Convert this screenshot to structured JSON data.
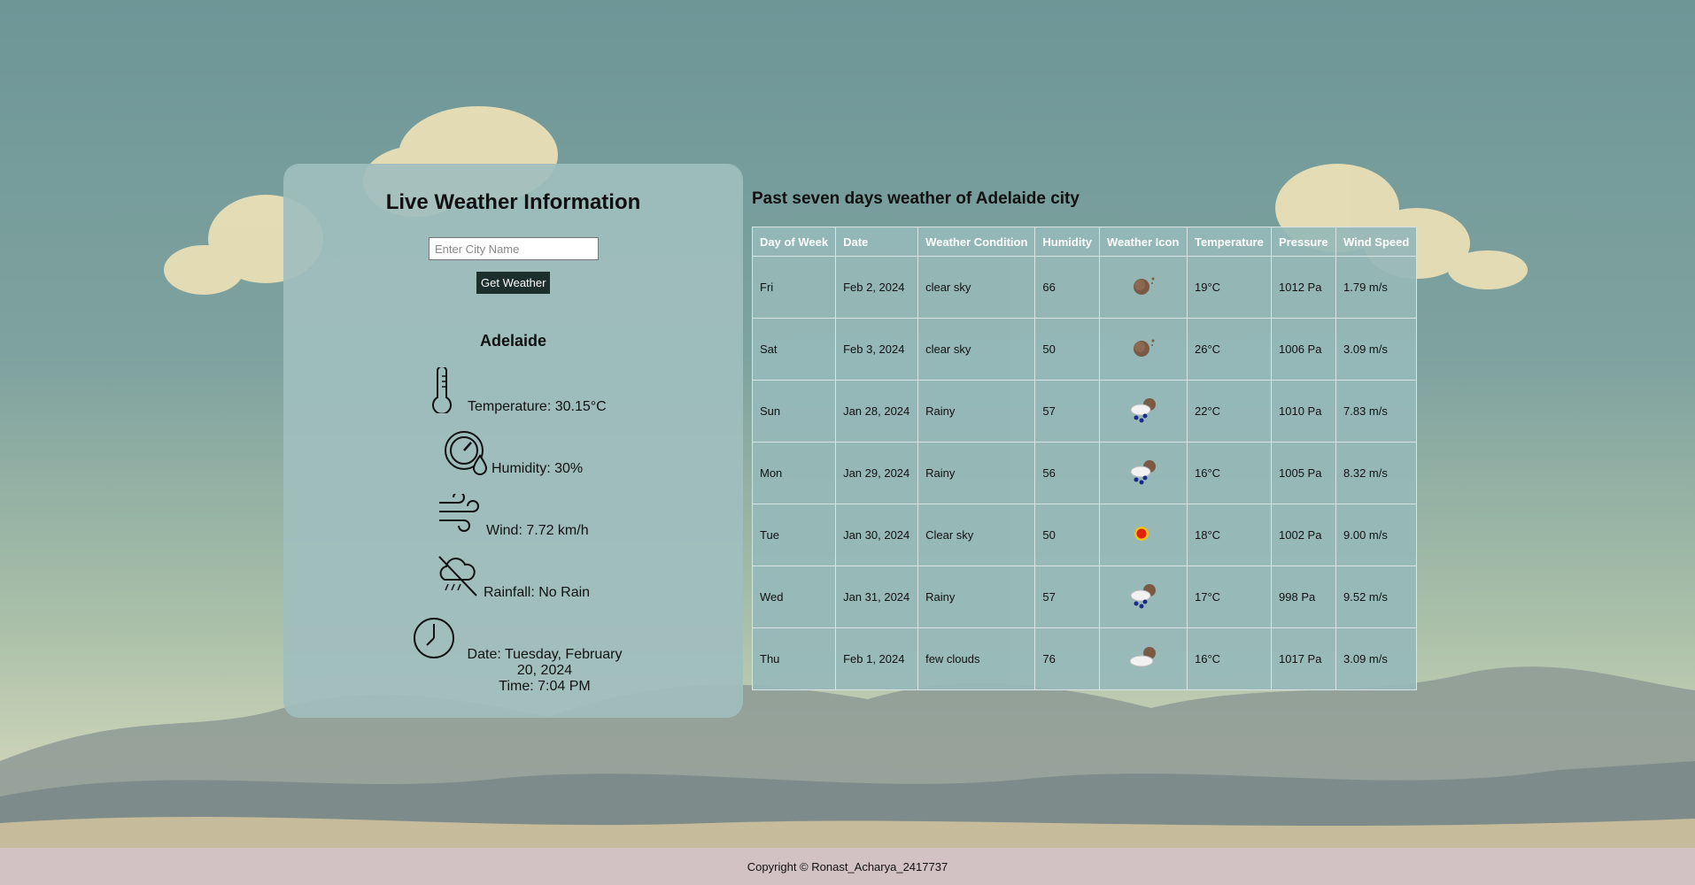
{
  "card": {
    "title": "Live Weather Information",
    "search_placeholder": "Enter City Name",
    "button_label": "Get Weather",
    "city": "Adelaide",
    "temperature": "Temperature: 30.15°C",
    "humidity": "Humidity: 30%",
    "wind": "Wind: 7.72 km/h",
    "rainfall": "Rainfall: No Rain",
    "date_line1": "Date: Tuesday, February",
    "date_line2": "20, 2024",
    "time": "Time: 7:04 PM"
  },
  "history": {
    "title": "Past seven days weather of Adelaide city",
    "headers": [
      "Day of Week",
      "Date",
      "Weather Condition",
      "Humidity",
      "Weather Icon",
      "Temperature",
      "Pressure",
      "Wind Speed"
    ],
    "rows": [
      {
        "day": "Fri",
        "date": "Feb 2, 2024",
        "condition": "clear sky",
        "humidity": "66",
        "icon": "clear-night-icon",
        "temp": "19°C",
        "pressure": "1012 Pa",
        "wind": "1.79 m/s"
      },
      {
        "day": "Sat",
        "date": "Feb 3, 2024",
        "condition": "clear sky",
        "humidity": "50",
        "icon": "clear-night-icon",
        "temp": "26°C",
        "pressure": "1006 Pa",
        "wind": "3.09 m/s"
      },
      {
        "day": "Sun",
        "date": "Jan 28, 2024",
        "condition": "Rainy",
        "humidity": "57",
        "icon": "rain-night-icon",
        "temp": "22°C",
        "pressure": "1010 Pa",
        "wind": "7.83 m/s"
      },
      {
        "day": "Mon",
        "date": "Jan 29, 2024",
        "condition": "Rainy",
        "humidity": "56",
        "icon": "rain-night-icon",
        "temp": "16°C",
        "pressure": "1005 Pa",
        "wind": "8.32 m/s"
      },
      {
        "day": "Tue",
        "date": "Jan 30, 2024",
        "condition": "Clear sky",
        "humidity": "50",
        "icon": "sun-icon",
        "temp": "18°C",
        "pressure": "1002 Pa",
        "wind": "9.00 m/s"
      },
      {
        "day": "Wed",
        "date": "Jan 31, 2024",
        "condition": "Rainy",
        "humidity": "57",
        "icon": "rain-night-icon",
        "temp": "17°C",
        "pressure": "998 Pa",
        "wind": "9.52 m/s"
      },
      {
        "day": "Thu",
        "date": "Feb 1, 2024",
        "condition": "few clouds",
        "humidity": "76",
        "icon": "few-clouds-night-icon",
        "temp": "16°C",
        "pressure": "1017 Pa",
        "wind": "3.09 m/s"
      }
    ]
  },
  "footer": {
    "copyright": "Copyright © Ronast_Acharya_2417737"
  },
  "colors": {
    "card_bg": "#9fbebe",
    "button_bg": "#1c2f2c",
    "footer_bg": "#d3c2c3",
    "sky": "#6e9697"
  }
}
